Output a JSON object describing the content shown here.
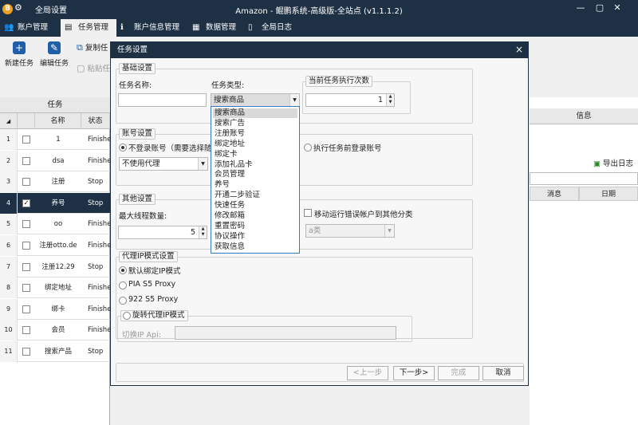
{
  "titlebar": {
    "logo": "B",
    "settings_label": "全局设置",
    "title": "Amazon - 鲲鹏系统-高级版-全站点 (v1.1.1.2)",
    "buttons": [
      "—",
      "▢",
      "✕"
    ]
  },
  "menu": {
    "items": [
      {
        "label": "账户管理",
        "icon": "users-icon"
      },
      {
        "label": "任务管理",
        "icon": "task-icon"
      },
      {
        "label": "账户信息管理",
        "icon": "info-icon"
      },
      {
        "label": "数据管理",
        "icon": "grid-icon"
      },
      {
        "label": "全局日志",
        "icon": "log-icon"
      }
    ]
  },
  "toolbar": {
    "new_task": "新建任务",
    "edit_task": "编辑任务",
    "copy_task": "复制任",
    "paste_task": "粘贴任"
  },
  "left_table": {
    "group_header": "任务",
    "col_name": "名称",
    "col_status": "状态",
    "rows": [
      {
        "num": "1",
        "name": "1",
        "status": "Finishe",
        "checked": false
      },
      {
        "num": "2",
        "name": "dsa",
        "status": "Finishe",
        "checked": false
      },
      {
        "num": "3",
        "name": "注册",
        "status": "Stop",
        "checked": false
      },
      {
        "num": "4",
        "name": "养号",
        "status": "Stop",
        "checked": true
      },
      {
        "num": "5",
        "name": "oo",
        "status": "Finishe",
        "checked": false
      },
      {
        "num": "6",
        "name": "注册otto.de",
        "status": "Finishe",
        "checked": false
      },
      {
        "num": "7",
        "name": "注册12.29",
        "status": "Stop",
        "checked": false
      },
      {
        "num": "8",
        "name": "绑定地址",
        "status": "Finishe",
        "checked": false
      },
      {
        "num": "9",
        "name": "绑卡",
        "status": "Finishe",
        "checked": false
      },
      {
        "num": "10",
        "name": "会员",
        "status": "Finishe",
        "checked": false
      },
      {
        "num": "11",
        "name": "搜索产品",
        "status": "Stop",
        "checked": false
      }
    ]
  },
  "right_pane": {
    "info_header": "信息",
    "export_log": "导出日志",
    "col_message": "消息",
    "col_date": "日期"
  },
  "dialog": {
    "title": "任务设置",
    "close": "×",
    "basic": {
      "legend": "基础设置",
      "task_name_label": "任务名称:",
      "task_name_value": "",
      "task_type_label": "任务类型:",
      "task_type_value": "搜索商品",
      "exec_legend": "当前任务执行次数",
      "exec_count": "1"
    },
    "account": {
      "legend": "账号设置",
      "opt_no_login": "不登录账号（需要选择随机",
      "opt_login_before": "执行任务前登录账号",
      "proxy_value": "不使用代理"
    },
    "other": {
      "legend": "其他设置",
      "max_threads_label": "最大线程数量:",
      "max_threads_value": "5",
      "move_error_label": "移动运行错误帐户到其他分类",
      "category_value": "a类"
    },
    "proxy_ip": {
      "legend": "代理IP模式设置",
      "opt_default": "默认绑定IP模式",
      "opt_pia": "PIA S5 Proxy",
      "opt_922": "922 S5 Proxy",
      "rotate_legend": "旋转代理IP模式",
      "switch_api_label": "切换IP Api:"
    },
    "buttons": {
      "prev": "<上一步",
      "next": "下一步>",
      "finish": "完成",
      "cancel": "取消"
    },
    "dropdown_options": [
      "搜索商品",
      "搜索广告",
      "注册账号",
      "绑定地址",
      "绑定卡",
      "添加礼品卡",
      "会员管理",
      "养号",
      "开通二步验证",
      "快速任务",
      "修改邮箱",
      "重置密码",
      "协议操作",
      "获取信息"
    ]
  }
}
